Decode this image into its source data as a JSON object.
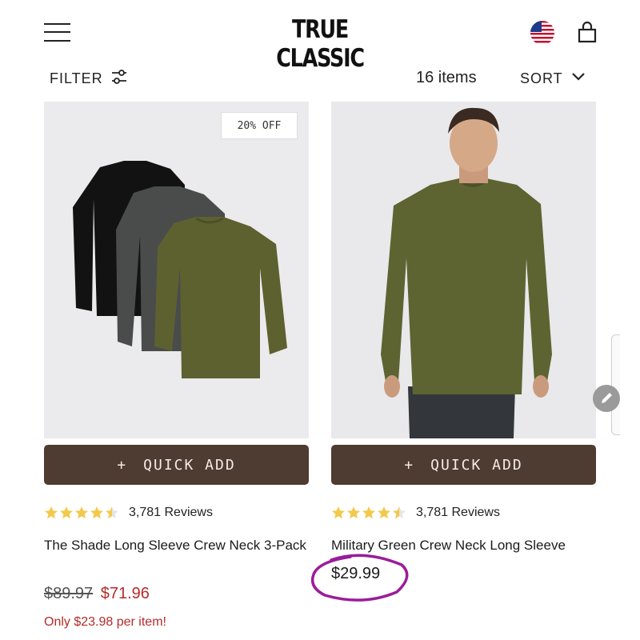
{
  "header": {
    "logo": "TRUE CLASSIC",
    "menu_icon": "hamburger-menu-icon",
    "flag_icon": "us-flag-icon",
    "bag_icon": "shopping-bag-icon"
  },
  "toolbar": {
    "filter_label": "FILTER",
    "filter_icon": "sliders-icon",
    "items_count": "16 items",
    "sort_label": "SORT",
    "sort_icon": "chevron-down-icon"
  },
  "products": [
    {
      "badge": "20% OFF",
      "quick_add": "QUICK ADD",
      "quick_add_plus": "+",
      "rating": 4.5,
      "reviews": "3,781 Reviews",
      "title": "The Shade Long Sleeve Crew Neck 3-Pack",
      "old_price": "$89.97",
      "sale_price": "$71.96",
      "per_item": "Only $23.98 per item!",
      "image_icon": "three-long-sleeve-shirts-image"
    },
    {
      "quick_add": "QUICK ADD",
      "quick_add_plus": "+",
      "rating": 4.5,
      "reviews": "3,781 Reviews",
      "title": "Military Green Crew Neck Long Sleeve",
      "price": "$29.99",
      "image_icon": "model-wearing-green-shirt-image"
    }
  ],
  "colors": {
    "quick_add_bg": "#4e3b31",
    "sale_red": "#b52b2b",
    "star_gold": "#f2c94c",
    "circle_mark": "#9b1c9b",
    "image_bg": "#ebebed"
  }
}
